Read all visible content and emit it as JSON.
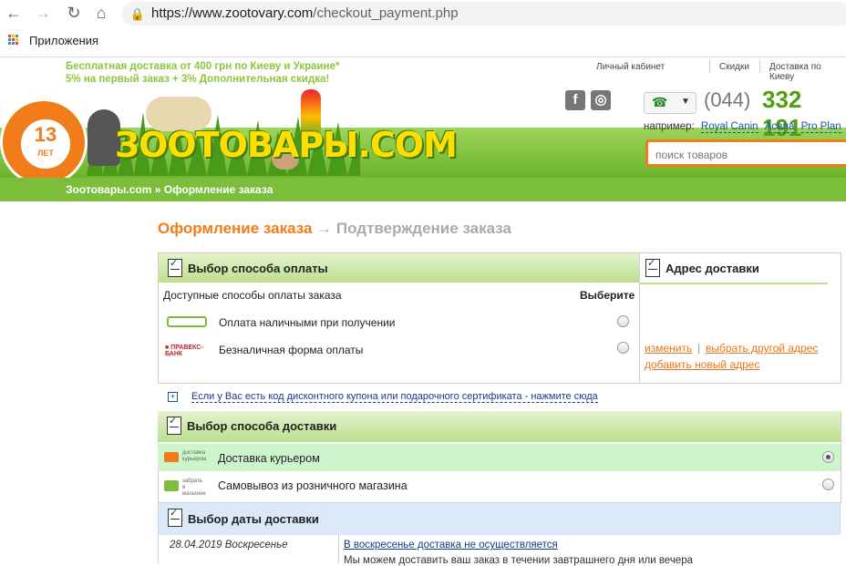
{
  "browser": {
    "url_main": "https://www.zootovary.com",
    "url_path": "/checkout_payment.php",
    "bookmark_label": "Приложения"
  },
  "header": {
    "promo_line1": "Бесплатная доставка от 400 грн по Киеву и Украине*",
    "promo_line2": "5% на первый заказ + 3% Дополнительная скидка!",
    "links": [
      "Личный кабинет",
      "Скидки",
      "Доставка по Киеву"
    ],
    "logo_text": "ЗООТОВАРЫ.COM",
    "badge_number": "13",
    "badge_sub": "ЛЕТ",
    "phone_code": "(044)",
    "phone_number": "332 191",
    "example_label": "например:",
    "example_links": [
      "Royal Canin",
      "Acana",
      "Pro Plan"
    ],
    "search_placeholder": "поиск товаров",
    "breadcrumb": "Зоотовары.com » Оформление заказа"
  },
  "steps": {
    "current": "Оформление заказа",
    "arrow": " → ",
    "next": "Подтверждение заказа"
  },
  "payment": {
    "title": "Выбор способа оплаты",
    "available_label": "Доступные способы оплаты заказа",
    "choose_label": "Выберите",
    "options": [
      {
        "label": "Оплата наличными при получении",
        "icon": "cash-on-delivery-icon",
        "selected": false
      },
      {
        "label": "Безналичная форма оплаты",
        "icon": "pravex-bank-icon",
        "selected": false
      }
    ],
    "coupon_text": "Если у Вас есть код дисконтного купона или подарочного сертификата - нажмите сюда"
  },
  "address": {
    "title": "Адрес доставки",
    "change": "изменить",
    "divider": "|",
    "choose_other": "выбрать другой адрес",
    "add_new": "добавить новый адрес"
  },
  "delivery": {
    "title": "Выбор способа доставки",
    "options": [
      {
        "label": "Доставка курьером",
        "icon": "courier-truck-icon",
        "selected": true
      },
      {
        "label": "Самовывоз из розничного магазина",
        "icon": "store-pickup-icon",
        "selected": false
      }
    ]
  },
  "delivery_date": {
    "title": "Выбор даты доставки",
    "date": "28.04.2019 Воскресенье",
    "note": "В воскресенье доставка не осуществляется",
    "sub": "Мы можем доставить ваш заказ в течении завтрашнего дня или вечера"
  },
  "colors": {
    "accent": "#f07d1a",
    "green": "#7cbd3b",
    "header_green": "#4ea012"
  }
}
